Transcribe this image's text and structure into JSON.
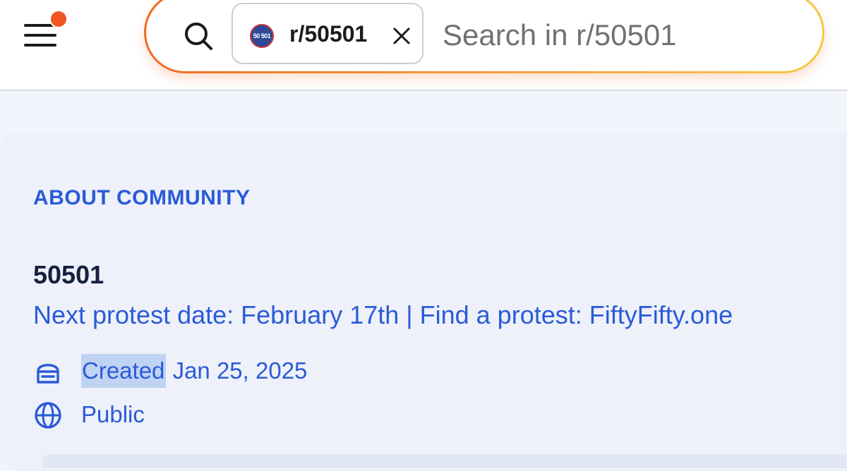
{
  "header": {
    "menu_icon": "hamburger-icon",
    "notification_dot_color": "#f0541f",
    "search": {
      "icon": "search-icon",
      "chip": {
        "avatar_text": "50 501",
        "label": "r/50501",
        "close_icon": "close-icon"
      },
      "placeholder": "Search in r/50501",
      "value": ""
    }
  },
  "about": {
    "section_title": "ABOUT COMMUNITY",
    "name": "50501",
    "description": "Next protest date: February 17th | Find a protest: FiftyFifty.one",
    "created": {
      "icon": "cake-icon",
      "label": "Created",
      "date": "Jan 25, 2025"
    },
    "visibility": {
      "icon": "globe-icon",
      "label": "Public"
    }
  },
  "colors": {
    "accent": "#2a5bd7",
    "title": "#17213e",
    "search_border_start": "#f26a21",
    "search_border_end": "#f6c847"
  }
}
